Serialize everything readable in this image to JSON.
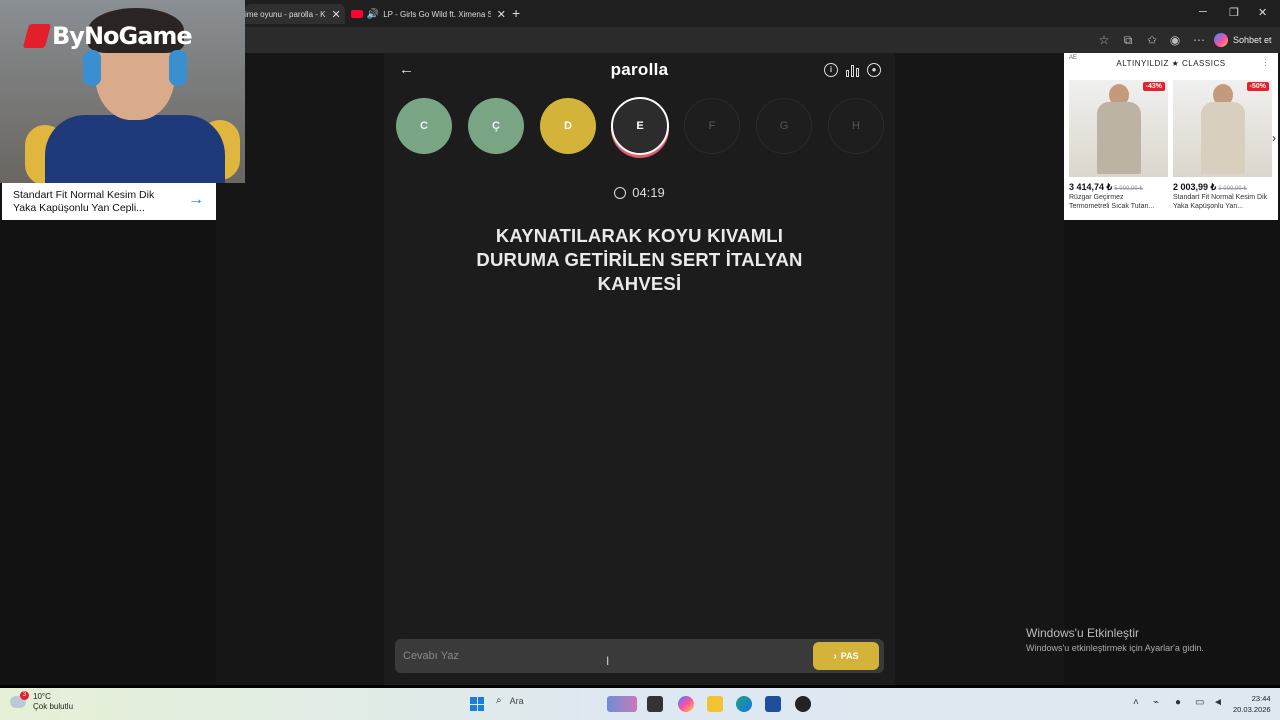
{
  "browser": {
    "tabs": [
      {
        "title": "ime oyunu - parolla - K",
        "active": true
      },
      {
        "title": "LP - Girls Go Wild ft. Ximena S",
        "active": false
      }
    ],
    "copilot_label": "Sohbet et"
  },
  "webcam": {
    "channel_logo": "ByNoGame"
  },
  "ad_left": {
    "text": "Standart Fit Normal Kesim Dik Yaka Kapüşonlu Yan Cepli..."
  },
  "app": {
    "title": "parolla",
    "letters": [
      {
        "letter": "C",
        "state": "done"
      },
      {
        "letter": "Ç",
        "state": "done"
      },
      {
        "letter": "D",
        "state": "skipped"
      },
      {
        "letter": "E",
        "state": "current"
      },
      {
        "letter": "F",
        "state": "todo"
      },
      {
        "letter": "G",
        "state": "todo"
      },
      {
        "letter": "H",
        "state": "todo"
      }
    ],
    "timer": "04:19",
    "question": "KAYNATILARAK KOYU KIVAMLI DURUMA GETİRİLEN SERT İTALYAN KAHVESİ",
    "answer_placeholder": "Cevabı Yaz",
    "pass_label": "PAS"
  },
  "ad_right": {
    "tag": "AE",
    "brand": "ALTINYILDIZ ★ CLASSICS",
    "products": [
      {
        "discount": "-43%",
        "price": "3 414,74 ₺",
        "old_price": "5 999,99 ₺",
        "name": "Rüzgar Geçirmez Termometreli Sıcak Tutan..."
      },
      {
        "discount": "-50%",
        "price": "2 003,99 ₺",
        "old_price": "3 999,99 ₺",
        "name": "Standart Fit Normal Kesim Dik Yaka Kapüşonlu Yan..."
      }
    ]
  },
  "windows_activation": {
    "title": "Windows'u Etkinleştir",
    "subtitle": "Windows'u etkinleştirmek için Ayarlar'a gidin."
  },
  "taskbar": {
    "weather_temp": "10°C",
    "weather_desc": "Çok bulutlu",
    "weather_badge": "3",
    "search_label": "Ara",
    "time": "23:44",
    "date": "20.03.2026"
  },
  "colors": {
    "done": "#7aa584",
    "skipped": "#d4b33a",
    "current_ring": "#e45b6b",
    "pass_button": "#d4b33a"
  }
}
